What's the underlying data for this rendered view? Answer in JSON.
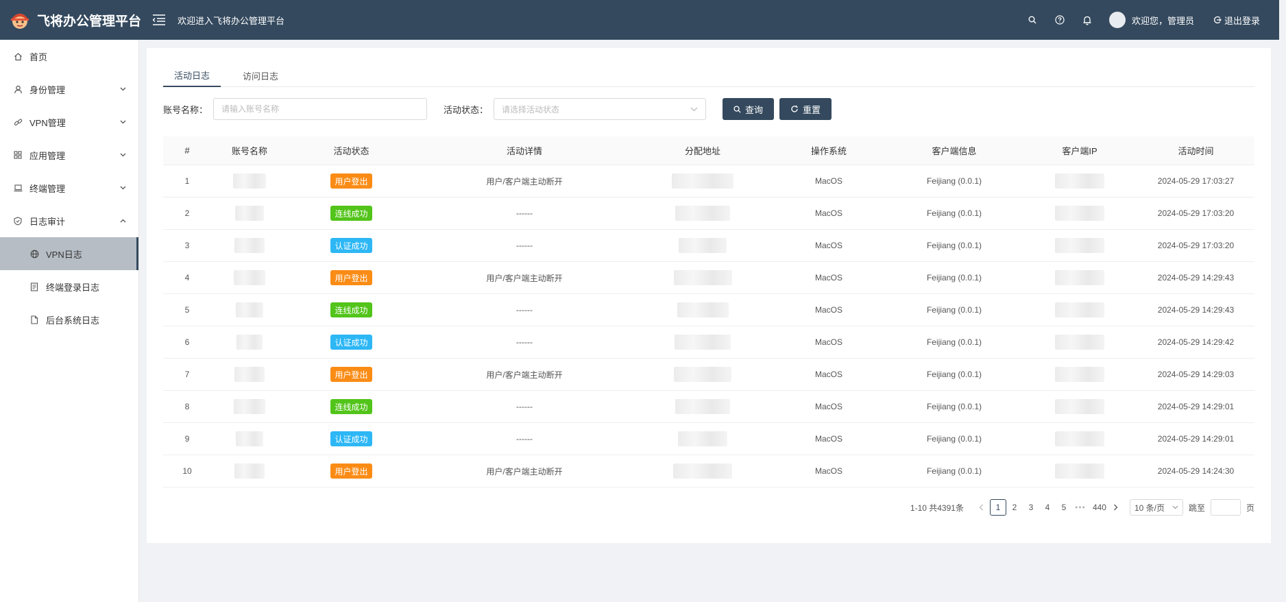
{
  "header": {
    "title": "飞将办公管理平台",
    "welcome": "欢迎进入飞将办公管理平台",
    "user_greeting": "欢迎您，管理员",
    "logout": "退出登录",
    "bg_color": "#34495e"
  },
  "sidebar": {
    "items": [
      {
        "label": "首页",
        "icon": "home-icon"
      },
      {
        "label": "身份管理",
        "icon": "user-icon"
      },
      {
        "label": "VPN管理",
        "icon": "link-icon"
      },
      {
        "label": "应用管理",
        "icon": "grid-icon"
      },
      {
        "label": "终端管理",
        "icon": "laptop-icon"
      },
      {
        "label": "日志审计",
        "icon": "shield-icon"
      }
    ],
    "subitems": [
      {
        "label": "VPN日志",
        "icon": "globe-icon",
        "active": true
      },
      {
        "label": "终端登录日志",
        "icon": "doc-icon"
      },
      {
        "label": "后台系统日志",
        "icon": "file-icon"
      }
    ]
  },
  "tabs": [
    {
      "label": "活动日志",
      "active": true
    },
    {
      "label": "访问日志",
      "active": false
    }
  ],
  "filters": {
    "account_label": "账号名称：",
    "account_placeholder": "请输入账号名称",
    "status_label": "活动状态：",
    "status_placeholder": "请选择活动状态",
    "search_btn": "查询",
    "reset_btn": "重置"
  },
  "table": {
    "columns": [
      "#",
      "账号名称",
      "活动状态",
      "活动详情",
      "分配地址",
      "操作系统",
      "客户端信息",
      "客户端IP",
      "活动时间"
    ],
    "rows": [
      {
        "no": "1",
        "status": "用户登出",
        "status_color": "#fa8c16",
        "detail": "用户/客户端主动断开",
        "os": "MacOS",
        "client": "Feijiang (0.0.1)",
        "time": "2024-05-29 17:03:27"
      },
      {
        "no": "2",
        "status": "连线成功",
        "status_color": "#52c41a",
        "detail": "------",
        "os": "MacOS",
        "client": "Feijiang (0.0.1)",
        "time": "2024-05-29 17:03:20"
      },
      {
        "no": "3",
        "status": "认证成功",
        "status_color": "#2db7f5",
        "detail": "------",
        "os": "MacOS",
        "client": "Feijiang (0.0.1)",
        "time": "2024-05-29 17:03:20"
      },
      {
        "no": "4",
        "status": "用户登出",
        "status_color": "#fa8c16",
        "detail": "用户/客户端主动断开",
        "os": "MacOS",
        "client": "Feijiang (0.0.1)",
        "time": "2024-05-29 14:29:43"
      },
      {
        "no": "5",
        "status": "连线成功",
        "status_color": "#52c41a",
        "detail": "------",
        "os": "MacOS",
        "client": "Feijiang (0.0.1)",
        "time": "2024-05-29 14:29:43"
      },
      {
        "no": "6",
        "status": "认证成功",
        "status_color": "#2db7f5",
        "detail": "------",
        "os": "MacOS",
        "client": "Feijiang (0.0.1)",
        "time": "2024-05-29 14:29:42"
      },
      {
        "no": "7",
        "status": "用户登出",
        "status_color": "#fa8c16",
        "detail": "用户/客户端主动断开",
        "os": "MacOS",
        "client": "Feijiang (0.0.1)",
        "time": "2024-05-29 14:29:03"
      },
      {
        "no": "8",
        "status": "连线成功",
        "status_color": "#52c41a",
        "detail": "------",
        "os": "MacOS",
        "client": "Feijiang (0.0.1)",
        "time": "2024-05-29 14:29:01"
      },
      {
        "no": "9",
        "status": "认证成功",
        "status_color": "#2db7f5",
        "detail": "------",
        "os": "MacOS",
        "client": "Feijiang (0.0.1)",
        "time": "2024-05-29 14:29:01"
      },
      {
        "no": "10",
        "status": "用户登出",
        "status_color": "#fa8c16",
        "detail": "用户/客户端主动断开",
        "os": "MacOS",
        "client": "Feijiang (0.0.1)",
        "time": "2024-05-29 14:24:30"
      }
    ]
  },
  "pagination": {
    "total": "1-10 共4391条",
    "pages": [
      "1",
      "2",
      "3",
      "4",
      "5"
    ],
    "ellipsis": "•••",
    "last": "440",
    "page_size": "10 条/页",
    "jump_label": "跳至",
    "page_suffix": "页"
  }
}
